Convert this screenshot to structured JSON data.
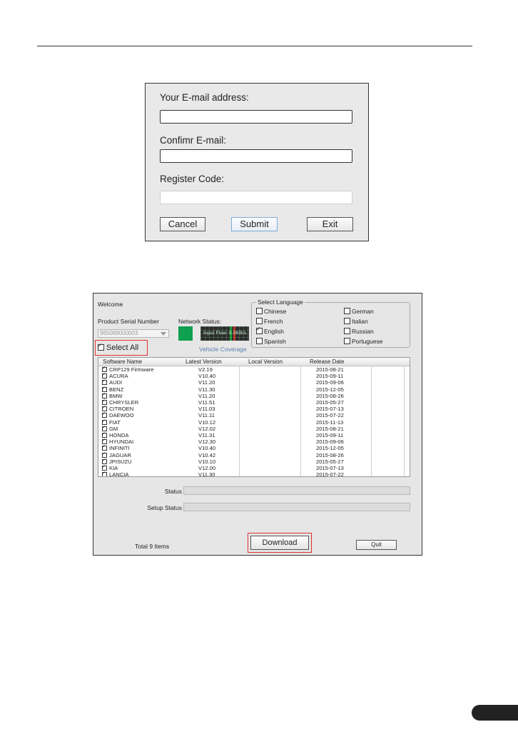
{
  "register": {
    "email_label": "Your E-mail address:",
    "email_value": "",
    "confirm_label": "Confimr E-mail:",
    "confirm_value": "",
    "code_label": "Register Code:",
    "code_value": "",
    "cancel": "Cancel",
    "submit": "Submit",
    "exit": "Exit"
  },
  "update": {
    "welcome": "Welcome",
    "serial_label": "Product Serial Number",
    "serial_value": "965089000003",
    "network_label": "Network Status:",
    "input_flow": "Input Flow: 0.0KB/s",
    "language_title": "Select Language",
    "languages": [
      {
        "label": "Chinese",
        "checked": false
      },
      {
        "label": "French",
        "checked": false
      },
      {
        "label": "English",
        "checked": true
      },
      {
        "label": "Spanish",
        "checked": false
      },
      {
        "label": "German",
        "checked": false
      },
      {
        "label": "Italian",
        "checked": false
      },
      {
        "label": "Russian",
        "checked": false
      },
      {
        "label": "Portuguese",
        "checked": false
      }
    ],
    "select_all": "Select All",
    "vehicle_coverage": "Vehicle Coverage",
    "columns": [
      "Software Name",
      "Latest Version",
      "Local Version",
      "Release Date"
    ],
    "rows": [
      {
        "name": "CRP129 Firmware",
        "latest": "V2.19",
        "local": "",
        "date": "2015-08-21"
      },
      {
        "name": "ACURA",
        "latest": "V10.40",
        "local": "",
        "date": "2015-09-11"
      },
      {
        "name": "AUDI",
        "latest": "V11.20",
        "local": "",
        "date": "2015-09-06"
      },
      {
        "name": "BENZ",
        "latest": "V11.30",
        "local": "",
        "date": "2015-12-05"
      },
      {
        "name": "BMW",
        "latest": "V11.20",
        "local": "",
        "date": "2015-08-26"
      },
      {
        "name": "CHRYSLER",
        "latest": "V11.51",
        "local": "",
        "date": "2015-05-27"
      },
      {
        "name": "CITROEN",
        "latest": "V11.03",
        "local": "",
        "date": "2015-07-13"
      },
      {
        "name": "DAEWOO",
        "latest": "V11.11",
        "local": "",
        "date": "2015-07-22"
      },
      {
        "name": "FIAT",
        "latest": "V10.12",
        "local": "",
        "date": "2015-11-13"
      },
      {
        "name": "GM",
        "latest": "V12.02",
        "local": "",
        "date": "2015-08-21"
      },
      {
        "name": "HONDA",
        "latest": "V11.31",
        "local": "",
        "date": "2015-09-11"
      },
      {
        "name": "HYUNDAI",
        "latest": "V12.30",
        "local": "",
        "date": "2015-09-06"
      },
      {
        "name": "INFINITI",
        "latest": "V10.40",
        "local": "",
        "date": "2015-12-05"
      },
      {
        "name": "JAGUAR",
        "latest": "V10.42",
        "local": "",
        "date": "2015-08-26"
      },
      {
        "name": "JPISUZU",
        "latest": "V10.10",
        "local": "",
        "date": "2015-05-27"
      },
      {
        "name": "KIA",
        "latest": "V12.00",
        "local": "",
        "date": "2015-07-13"
      },
      {
        "name": "LANCIA",
        "latest": "V11.30",
        "local": "",
        "date": "2015-07-22"
      }
    ],
    "status_label": "Status",
    "setup_status_label": "Setup Status",
    "total": "Total 9 Items",
    "download": "Download",
    "quit": "Quit"
  },
  "colors": {
    "network_ok": "#0fa050",
    "highlight_frame": "#e03030",
    "link": "#5a7fb0"
  }
}
